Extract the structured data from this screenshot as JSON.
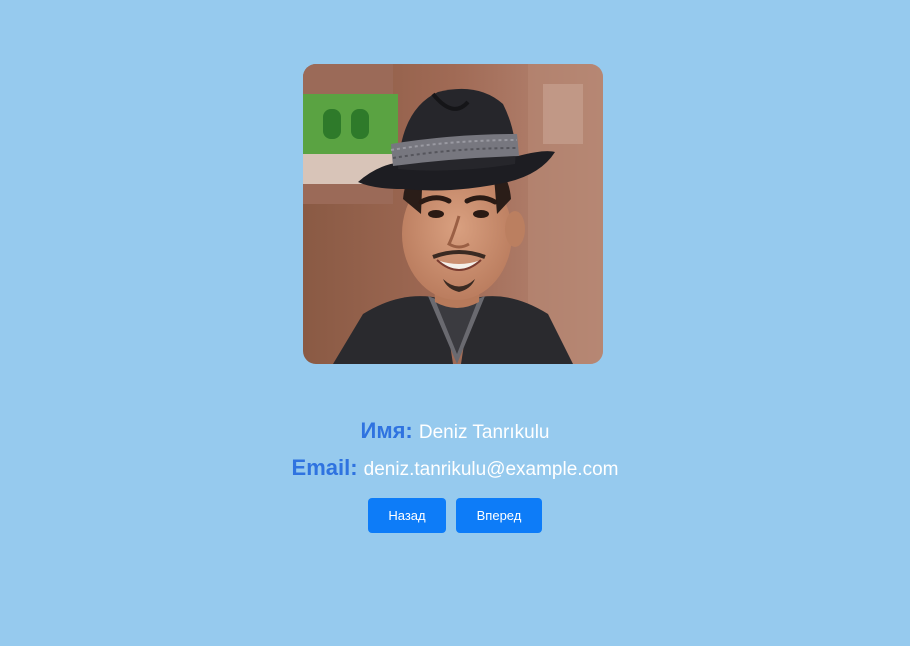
{
  "profile": {
    "photo_icon": "person-photo",
    "name_label": "Имя:",
    "name_value": "Deniz Tanrıkulu",
    "email_label": "Email:",
    "email_value": "deniz.tanrikulu@example.com"
  },
  "navigation": {
    "back_label": "Назад",
    "forward_label": "Вперед"
  },
  "colors": {
    "background": "#96caee",
    "label": "#2f73e0",
    "value": "#ffffff",
    "button": "#0d7cf8"
  }
}
